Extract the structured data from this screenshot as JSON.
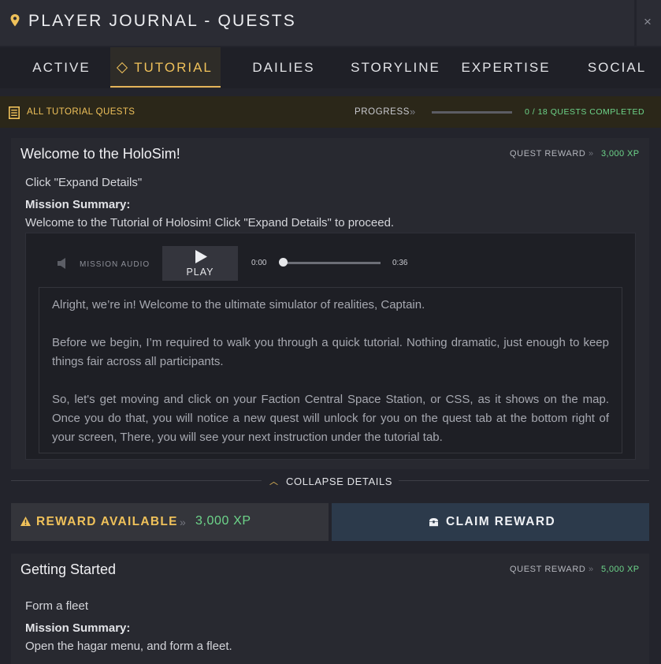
{
  "header": {
    "title": "PLAYER JOURNAL - QUESTS",
    "close_symbol": "×"
  },
  "tabs": [
    {
      "label": "ACTIVE",
      "active": false
    },
    {
      "label": "TUTORIAL",
      "active": true
    },
    {
      "label": "DAILIES",
      "active": false
    },
    {
      "label": "STORYLINE",
      "active": false
    },
    {
      "label": "EXPERTISE",
      "active": false
    },
    {
      "label": "SOCIAL",
      "active": false
    }
  ],
  "filter": {
    "label": "ALL TUTORIAL QUESTS",
    "progress_label": "PROGRESS",
    "progress_arrows": "»",
    "progress_fraction": 0,
    "progress_text": "0 / 18 QUESTS COMPLETED"
  },
  "quests": [
    {
      "title": "Welcome to the HoloSim!",
      "reward_label": "QUEST REWARD",
      "reward_arrows": "»",
      "reward_value": "3,000 XP",
      "objective": "Click \"Expand Details\"",
      "summary_label": "Mission Summary:",
      "summary_text": "Welcome to the Tutorial of Holosim! Click \"Expand Details\" to proceed.",
      "audio": {
        "label": "MISSION AUDIO",
        "play_label": "PLAY",
        "time_start": "0:00",
        "time_end": "0:36",
        "position_fraction": 0
      },
      "transcript": [
        "Alright, we’re in! Welcome to the ultimate simulator of realities, Captain.",
        "Before we begin, I’m required to walk you through a quick tutorial. Nothing dramatic, just enough to keep things fair across all participants.",
        "So, let's get moving and click on your Faction Central Space Station, or CSS, as it shows on the map. Once you do that, you will notice a new quest will unlock for you on the quest tab at the bottom right of your screen, There, you will see your next instruction under the tutorial tab."
      ],
      "collapse_label": "COLLAPSE DETAILS",
      "reward_available_label": "REWARD AVAILABLE",
      "reward_available_arrows": "»",
      "reward_available_xp": "3,000 XP",
      "claim_label": "CLAIM REWARD"
    },
    {
      "title": "Getting Started",
      "reward_label": "QUEST REWARD",
      "reward_arrows": "»",
      "reward_value": "5,000 XP",
      "objective": "Form a fleet",
      "summary_label": "Mission Summary:",
      "summary_text": "Open the hagar menu, and form a fleet."
    }
  ],
  "colors": {
    "accent_gold": "#efc15a",
    "xp_green": "#6dd58a",
    "claim_button": "#2c3a4b",
    "background": "#23242c"
  },
  "icons": [
    "map-pin-icon",
    "close-icon",
    "diamond-icon",
    "list-icon",
    "speaker-icon",
    "play-icon",
    "chevron-up-icon",
    "warning-icon",
    "chest-icon"
  ]
}
